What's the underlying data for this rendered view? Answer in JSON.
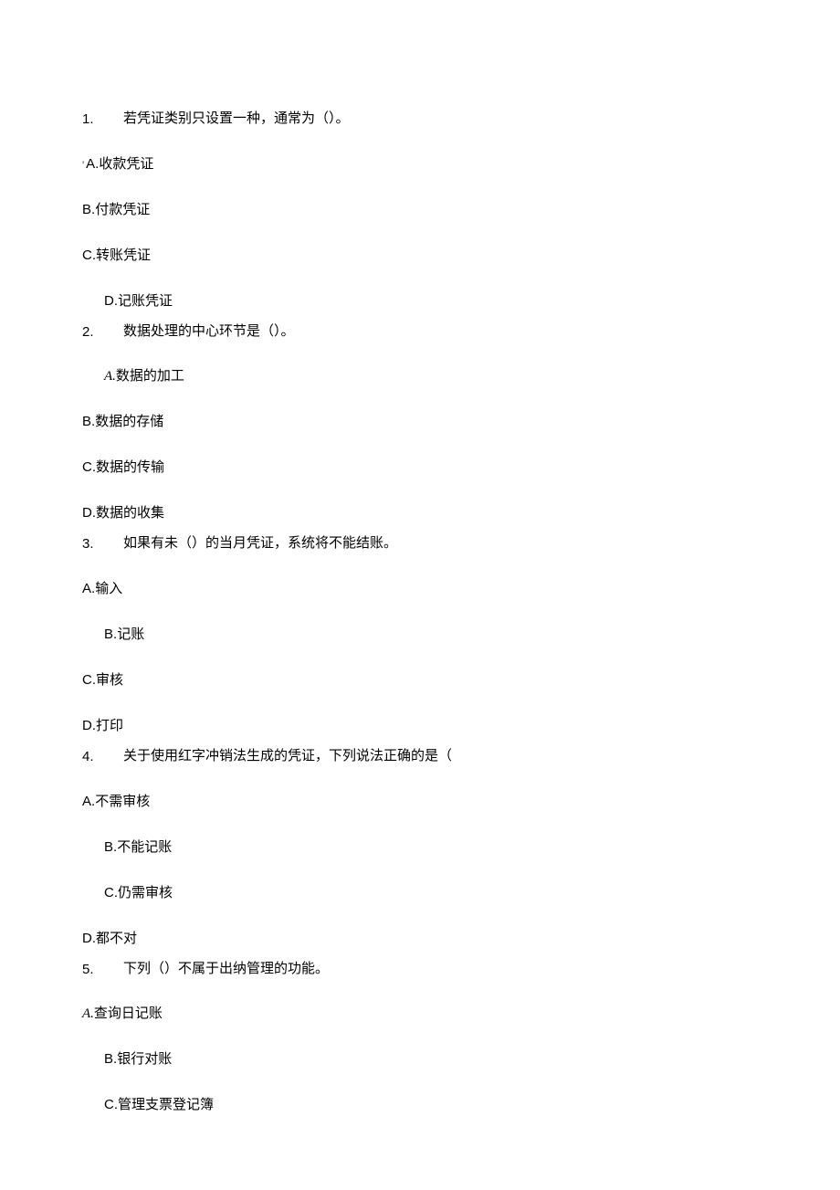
{
  "questions": [
    {
      "num": "1.",
      "text": "若凭证类别只设置一种，通常为（）。",
      "options": [
        {
          "pre": "'",
          "label": "A.",
          "text": "收款凭证",
          "indented": false
        },
        {
          "pre": "",
          "label": "B.",
          "text": "付款凭证",
          "indented": false
        },
        {
          "pre": "",
          "label": "C.",
          "text": "转账凭证",
          "indented": false
        },
        {
          "pre": "",
          "label": "D.",
          "text": "记账凭证",
          "indented": true
        }
      ]
    },
    {
      "num": "2.",
      "text": "数据处理的中心环节是（）。",
      "options": [
        {
          "pre": "",
          "label": "A.",
          "text": "数据的加工",
          "indented": true,
          "italic": true
        },
        {
          "pre": "",
          "label": "B.",
          "text": "数据的存储",
          "indented": false
        },
        {
          "pre": "",
          "label": "C.",
          "text": "数据的传输",
          "indented": false
        },
        {
          "pre": "",
          "label": "D.",
          "text": "数据的收集",
          "indented": false
        }
      ]
    },
    {
      "num": "3.",
      "text": "如果有未（）的当月凭证，系统将不能结账。",
      "options": [
        {
          "pre": "",
          "label": "A.",
          "text": "输入",
          "indented": false
        },
        {
          "pre": "",
          "label": "B.",
          "text": "记账",
          "indented": true
        },
        {
          "pre": "",
          "label": "C.",
          "text": "审核",
          "indented": false
        },
        {
          "pre": "",
          "label": "D.",
          "text": "打印",
          "indented": false
        }
      ]
    },
    {
      "num": "4.",
      "text": "关于使用红字冲销法生成的凭证，下列说法正确的是（",
      "options": [
        {
          "pre": "",
          "label": "A.",
          "text": "不需审核",
          "indented": false
        },
        {
          "pre": "",
          "label": "B.",
          "text": "不能记账",
          "indented": true
        },
        {
          "pre": "",
          "label": "C.",
          "text": "仍需审核",
          "indented": true
        },
        {
          "pre": "",
          "label": "D.",
          "text": "都不对",
          "indented": false
        }
      ]
    },
    {
      "num": "5.",
      "text": "下列（）不属于出纳管理的功能。",
      "options": [
        {
          "pre": "",
          "label": "A.",
          "text": "查询日记账",
          "indented": false,
          "italic": true
        },
        {
          "pre": "",
          "label": "B.",
          "text": "银行对账",
          "indented": true
        },
        {
          "pre": "",
          "label": "C.",
          "text": "管理支票登记簿",
          "indented": true
        }
      ]
    }
  ]
}
